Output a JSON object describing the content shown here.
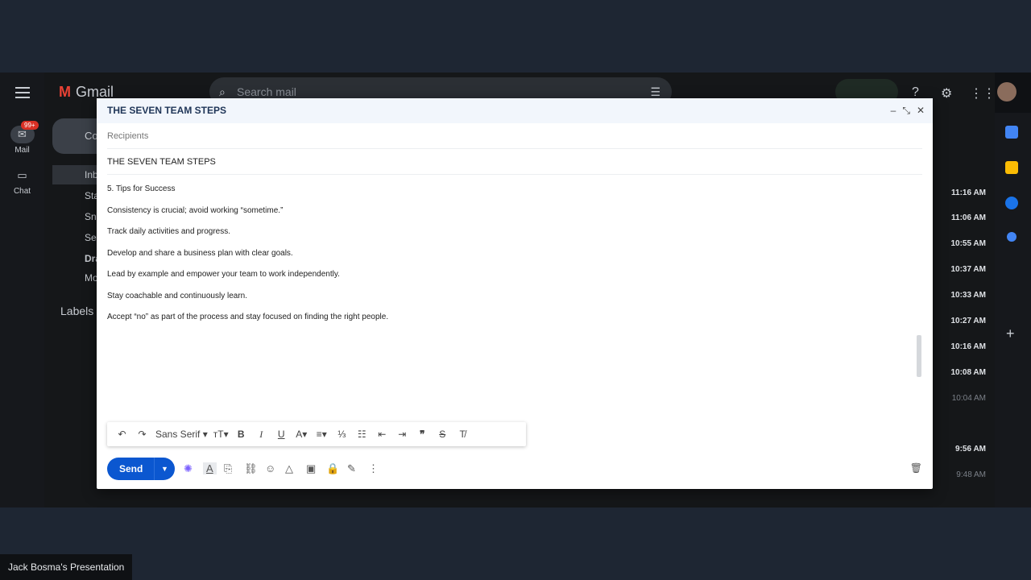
{
  "gmail": {
    "logo": "Gmail",
    "search_placeholder": "Search mail",
    "rail": {
      "mail_label": "Mail",
      "mail_badge": "99+",
      "chat_label": "Chat"
    },
    "compose_label": "Co",
    "nav": [
      "Inb",
      "Sta",
      "Sno",
      "Se",
      "Dra",
      "Mo"
    ],
    "labels_heading": "Labels",
    "times": [
      "11:16 AM",
      "11:06 AM",
      "10:55 AM",
      "10:37 AM",
      "10:33 AM",
      "10:27 AM",
      "10:16 AM",
      "10:08 AM",
      "10:04 AM",
      "9:56 AM",
      "9:48 AM"
    ]
  },
  "compose": {
    "window_title": "THE SEVEN TEAM STEPS",
    "recipients_placeholder": "Recipients",
    "subject": "THE SEVEN TEAM STEPS",
    "body": [
      "5. Tips for Success",
      "Consistency is crucial; avoid working “sometime.”",
      "Track daily activities and progress.",
      "Develop and share a business plan with clear goals.",
      "Lead by example and empower your team to work independently.",
      "Stay coachable and continuously learn.",
      "Accept “no” as part of the process and stay focused on finding the right people."
    ],
    "font_name": "Sans Serif",
    "send_label": "Send"
  },
  "presentation_label": "Jack Bosma's Presentation",
  "colors": {
    "send": "#0b57d0",
    "header_bg": "#f2f6fc",
    "backdrop": "#1e2633"
  }
}
